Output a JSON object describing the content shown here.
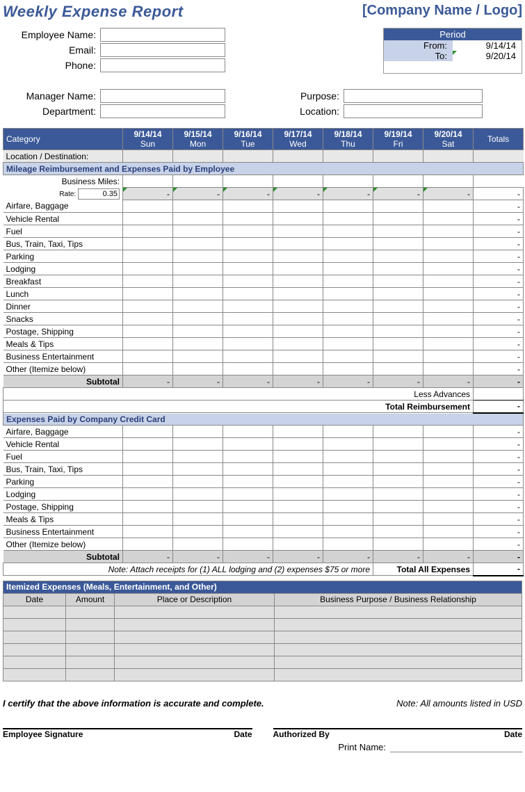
{
  "title": "Weekly Expense Report",
  "company": "[Company Name / Logo]",
  "employee": {
    "name_label": "Employee Name:",
    "email_label": "Email:",
    "phone_label": "Phone:",
    "manager_label": "Manager Name:",
    "department_label": "Department:",
    "purpose_label": "Purpose:",
    "location_label": "Location:"
  },
  "period": {
    "header": "Period",
    "from_label": "From:",
    "to_label": "To:",
    "from": "9/14/14",
    "to": "9/20/14"
  },
  "columns": {
    "category": "Category",
    "totals": "Totals",
    "days": [
      {
        "date": "9/14/14",
        "dow": "Sun"
      },
      {
        "date": "9/15/14",
        "dow": "Mon"
      },
      {
        "date": "9/16/14",
        "dow": "Tue"
      },
      {
        "date": "9/17/14",
        "dow": "Wed"
      },
      {
        "date": "9/18/14",
        "dow": "Thu"
      },
      {
        "date": "9/19/14",
        "dow": "Fri"
      },
      {
        "date": "9/20/14",
        "dow": "Sat"
      }
    ]
  },
  "loc_dest_label": "Location / Destination:",
  "section1": {
    "title": "Mileage Reimbursement and Expenses Paid by Employee",
    "business_miles": "Business Miles:",
    "rate_label": "Rate:",
    "rate_value": "0.35",
    "rows": [
      "Airfare, Baggage",
      "Vehicle Rental",
      "Fuel",
      "Bus, Train, Taxi, Tips",
      "Parking",
      "Lodging",
      "Breakfast",
      "Lunch",
      "Dinner",
      "Snacks",
      "Postage, Shipping",
      "Meals & Tips",
      "Business Entertainment",
      "Other (Itemize below)"
    ],
    "subtotal": "Subtotal",
    "less_advances": "Less Advances",
    "total_reimb": "Total Reimbursement",
    "dash": "-"
  },
  "section2": {
    "title": "Expenses Paid by Company Credit Card",
    "rows": [
      "Airfare, Baggage",
      "Vehicle Rental",
      "Fuel",
      "Bus, Train, Taxi, Tips",
      "Parking",
      "Lodging",
      "Postage, Shipping",
      "Meals & Tips",
      "Business Entertainment",
      "Other (Itemize below)"
    ],
    "subtotal": "Subtotal",
    "note": "Note:   Attach receipts for (1) ALL lodging and (2) expenses $75 or more",
    "total_all": "Total All Expenses",
    "dash": "-"
  },
  "itemized": {
    "title": " Itemized Expenses (Meals, Entertainment, and Other)",
    "cols": {
      "date": "Date",
      "amount": "Amount",
      "place": "Place or Description",
      "purpose": "Business Purpose / Business Relationship"
    }
  },
  "cert": "I certify that the above information is accurate and complete.",
  "usd_note": "Note: All amounts listed in USD",
  "sig": {
    "emp": "Employee Signature",
    "auth": "Authorized By",
    "date": "Date",
    "print": "Print Name:"
  }
}
